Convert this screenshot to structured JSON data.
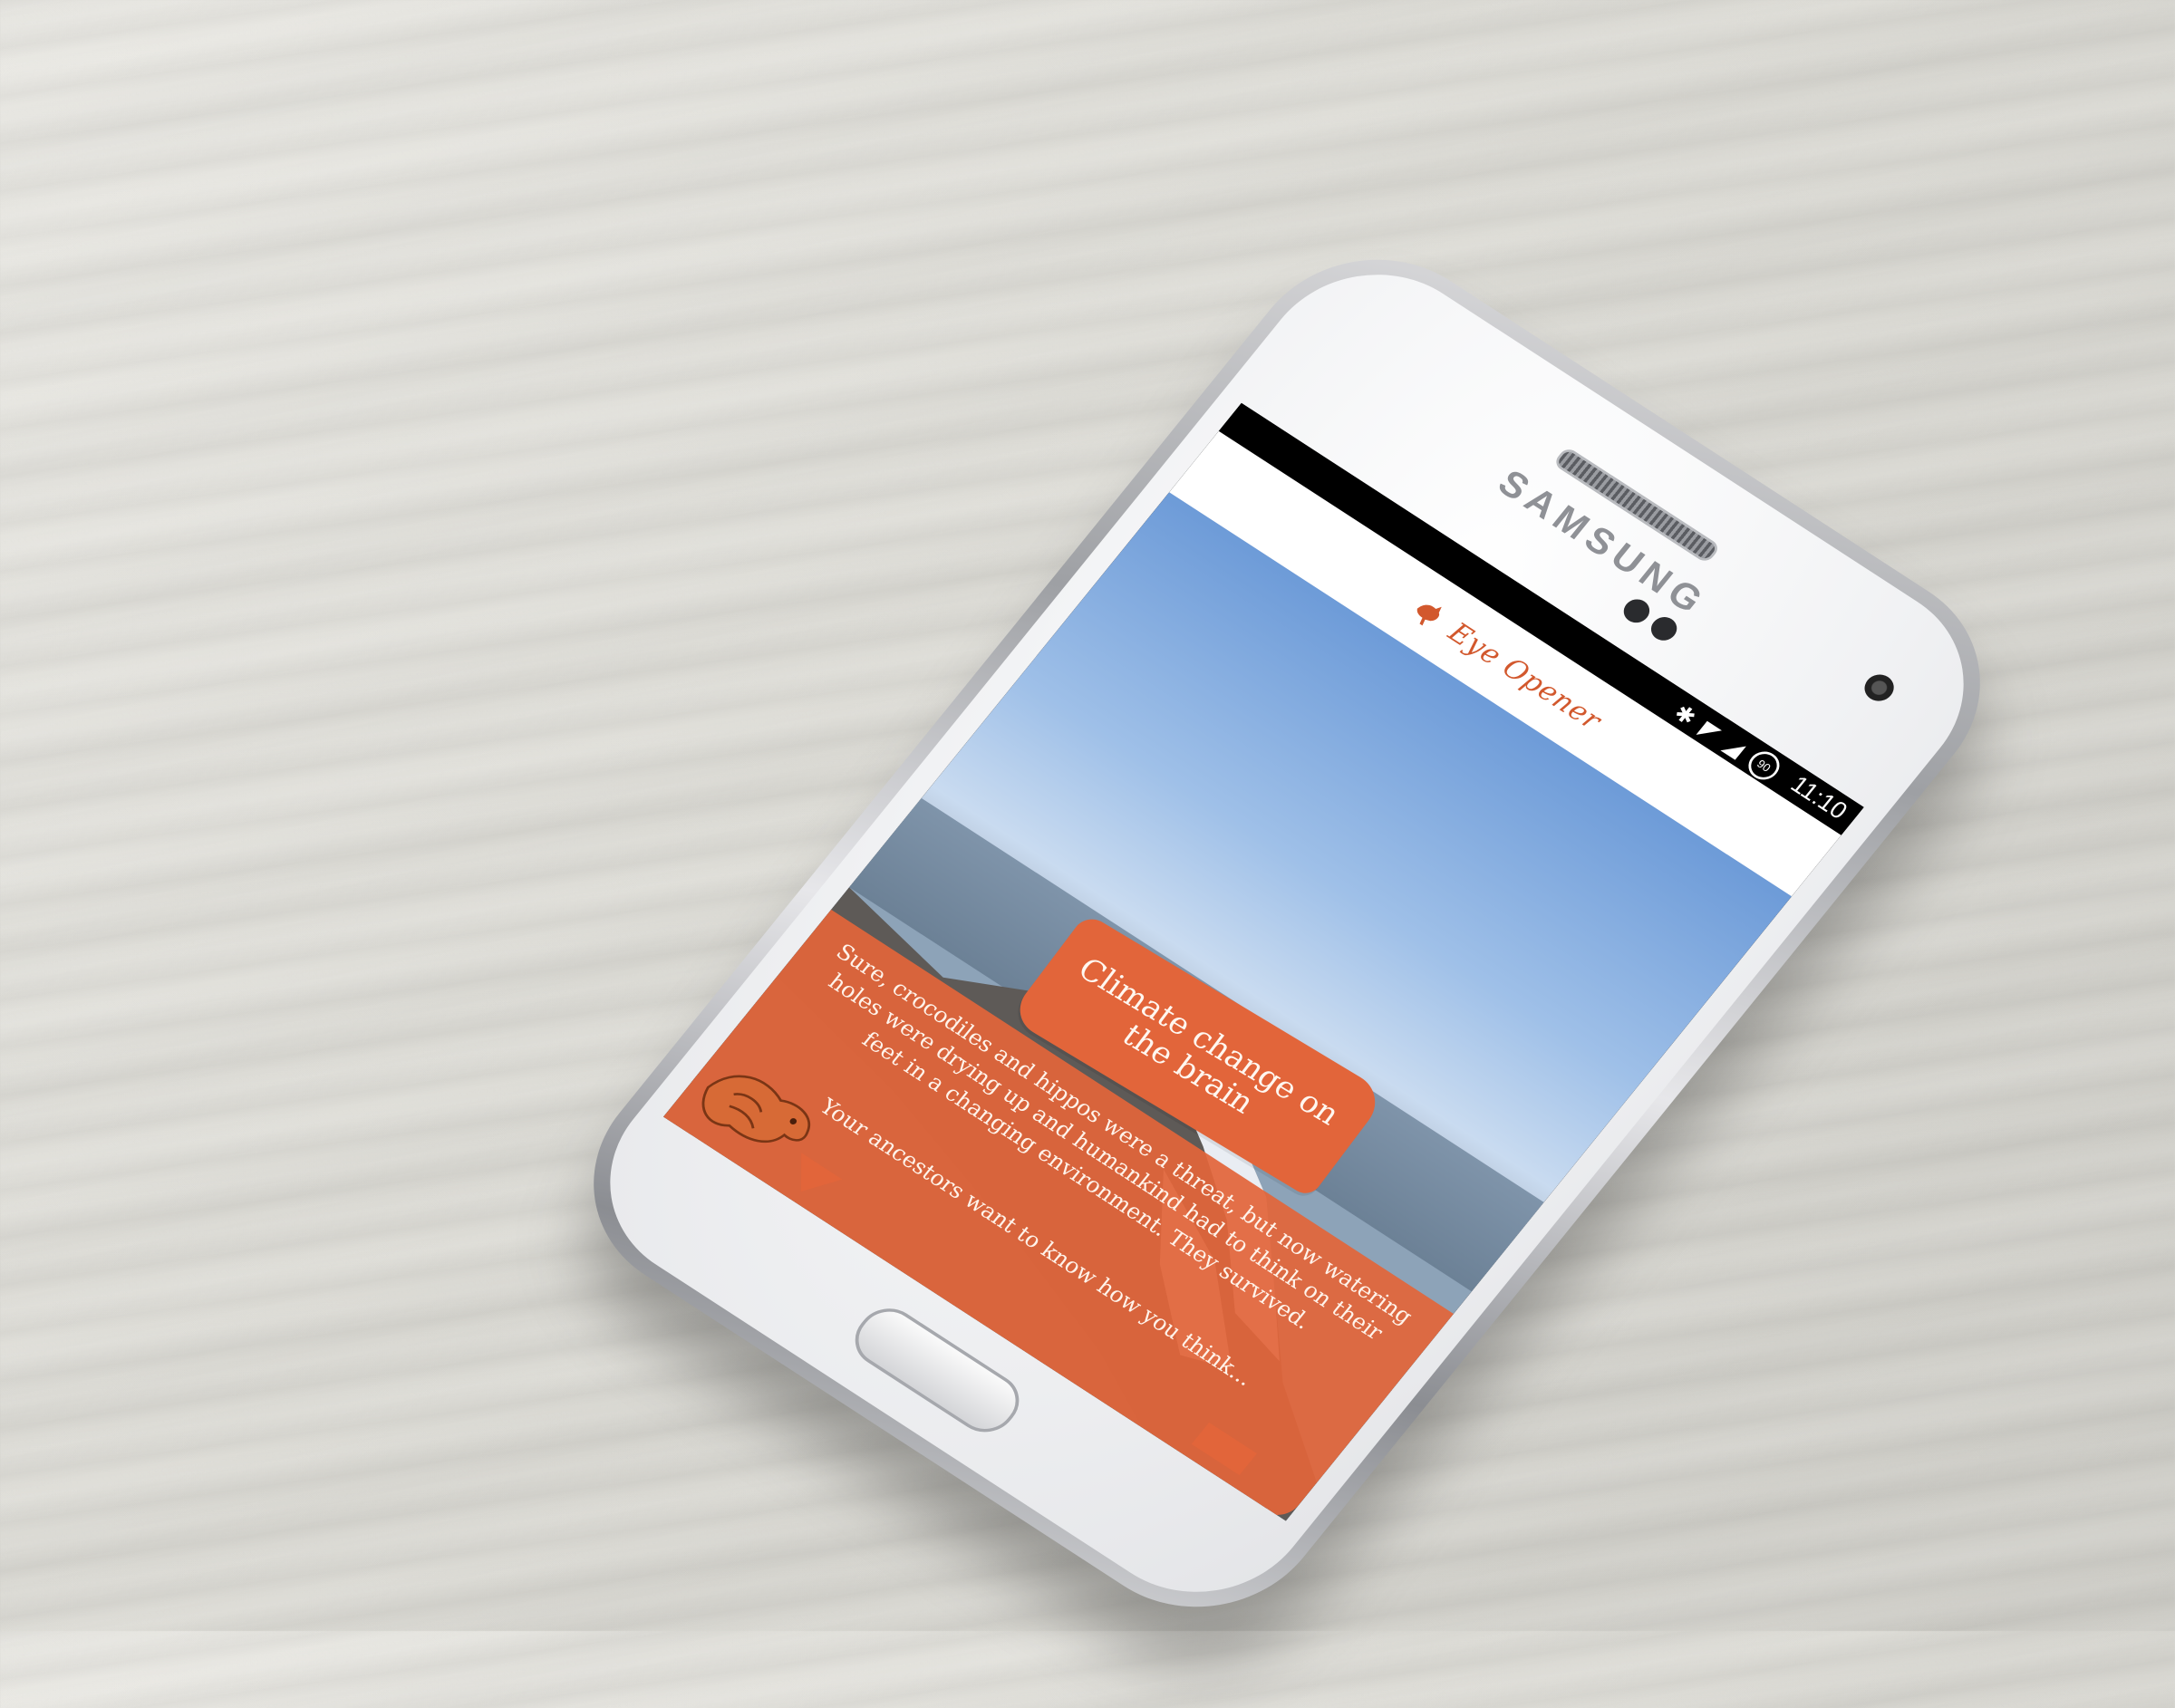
{
  "device": {
    "brand": "SAMSUNG"
  },
  "statusbar": {
    "time": "11:10",
    "battery_badge": "90",
    "icons": [
      "bluetooth-icon",
      "wifi-icon",
      "signal-icon",
      "battery-icon"
    ]
  },
  "app": {
    "title": "Eye Opener",
    "logo_icon": "rooster-icon"
  },
  "content": {
    "headline": "Climate change on the brain",
    "body": "Sure, crocodiles and hippos were a threat, but now watering holes were drying up and humankind had to think on their feet in a changing environment. They survived.",
    "cta": "Your ancestors want to know how you think...",
    "mascot_icon": "bull-icon"
  },
  "colors": {
    "accent": "#e2653a",
    "title_text": "#d2582d"
  }
}
